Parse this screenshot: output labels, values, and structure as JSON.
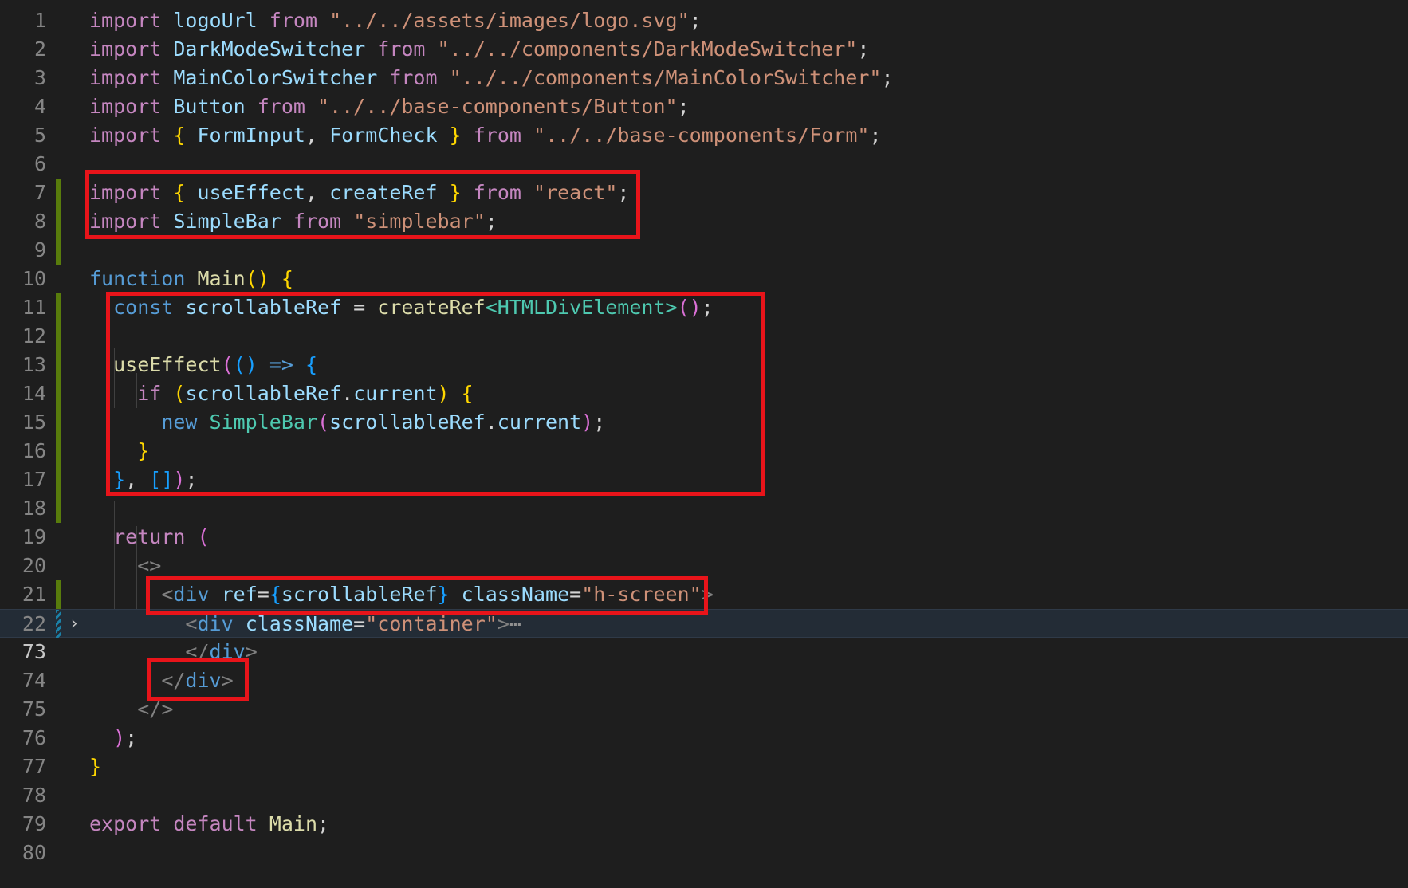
{
  "editor": {
    "lines": [
      {
        "n": "1",
        "tokens": [
          [
            "kw",
            "import"
          ],
          [
            "p",
            " "
          ],
          [
            "vr",
            "logoUrl"
          ],
          [
            "p",
            " "
          ],
          [
            "kw",
            "from"
          ],
          [
            "p",
            " "
          ],
          [
            "st",
            "\"../../assets/images/logo.svg\""
          ],
          [
            "p",
            ";"
          ]
        ]
      },
      {
        "n": "2",
        "tokens": [
          [
            "kw",
            "import"
          ],
          [
            "p",
            " "
          ],
          [
            "vr",
            "DarkModeSwitcher"
          ],
          [
            "p",
            " "
          ],
          [
            "kw",
            "from"
          ],
          [
            "p",
            " "
          ],
          [
            "st",
            "\"../../components/DarkModeSwitcher\""
          ],
          [
            "p",
            ";"
          ]
        ]
      },
      {
        "n": "3",
        "tokens": [
          [
            "kw",
            "import"
          ],
          [
            "p",
            " "
          ],
          [
            "vr",
            "MainColorSwitcher"
          ],
          [
            "p",
            " "
          ],
          [
            "kw",
            "from"
          ],
          [
            "p",
            " "
          ],
          [
            "st",
            "\"../../components/MainColorSwitcher\""
          ],
          [
            "p",
            ";"
          ]
        ]
      },
      {
        "n": "4",
        "tokens": [
          [
            "kw",
            "import"
          ],
          [
            "p",
            " "
          ],
          [
            "vr",
            "Button"
          ],
          [
            "p",
            " "
          ],
          [
            "kw",
            "from"
          ],
          [
            "p",
            " "
          ],
          [
            "st",
            "\"../../base-components/Button\""
          ],
          [
            "p",
            ";"
          ]
        ]
      },
      {
        "n": "5",
        "tokens": [
          [
            "kw",
            "import"
          ],
          [
            "p",
            " "
          ],
          [
            "p1",
            "{"
          ],
          [
            "p",
            " "
          ],
          [
            "vr",
            "FormInput"
          ],
          [
            "p",
            ", "
          ],
          [
            "vr",
            "FormCheck"
          ],
          [
            "p",
            " "
          ],
          [
            "p1",
            "}"
          ],
          [
            "p",
            " "
          ],
          [
            "kw",
            "from"
          ],
          [
            "p",
            " "
          ],
          [
            "st",
            "\"../../base-components/Form\""
          ],
          [
            "p",
            ";"
          ]
        ]
      },
      {
        "n": "6",
        "tokens": []
      },
      {
        "n": "7",
        "tokens": [
          [
            "kw",
            "import"
          ],
          [
            "p",
            " "
          ],
          [
            "p1",
            "{"
          ],
          [
            "p",
            " "
          ],
          [
            "vr",
            "useEffect"
          ],
          [
            "p",
            ", "
          ],
          [
            "vr",
            "createRef"
          ],
          [
            "p",
            " "
          ],
          [
            "p1",
            "}"
          ],
          [
            "p",
            " "
          ],
          [
            "kw",
            "from"
          ],
          [
            "p",
            " "
          ],
          [
            "st",
            "\"react\""
          ],
          [
            "p",
            ";"
          ]
        ]
      },
      {
        "n": "8",
        "tokens": [
          [
            "kw",
            "import"
          ],
          [
            "p",
            " "
          ],
          [
            "vr",
            "SimpleBar"
          ],
          [
            "p",
            " "
          ],
          [
            "kw",
            "from"
          ],
          [
            "p",
            " "
          ],
          [
            "st",
            "\"simplebar\""
          ],
          [
            "p",
            ";"
          ]
        ]
      },
      {
        "n": "9",
        "tokens": []
      },
      {
        "n": "10",
        "tokens": [
          [
            "bl",
            "function"
          ],
          [
            "p",
            " "
          ],
          [
            "fn",
            "Main"
          ],
          [
            "p1",
            "()"
          ],
          [
            "p",
            " "
          ],
          [
            "p1",
            "{"
          ]
        ]
      },
      {
        "n": "11",
        "tokens": [
          [
            "p",
            "  "
          ],
          [
            "bl",
            "const"
          ],
          [
            "p",
            " "
          ],
          [
            "vr",
            "scrollableRef"
          ],
          [
            "p",
            " = "
          ],
          [
            "fn",
            "createRef"
          ],
          [
            "ty",
            "<HTMLDivElement>"
          ],
          [
            "p2",
            "()"
          ],
          [
            "p",
            ";"
          ]
        ]
      },
      {
        "n": "12",
        "tokens": []
      },
      {
        "n": "13",
        "tokens": [
          [
            "p",
            "  "
          ],
          [
            "fn",
            "useEffect"
          ],
          [
            "p2",
            "("
          ],
          [
            "p3",
            "()"
          ],
          [
            "p",
            " "
          ],
          [
            "bl",
            "=>"
          ],
          [
            "p",
            " "
          ],
          [
            "p3",
            "{"
          ]
        ]
      },
      {
        "n": "14",
        "tokens": [
          [
            "p",
            "    "
          ],
          [
            "kw",
            "if"
          ],
          [
            "p",
            " "
          ],
          [
            "p1",
            "("
          ],
          [
            "vr",
            "scrollableRef"
          ],
          [
            "p",
            "."
          ],
          [
            "vr",
            "current"
          ],
          [
            "p1",
            ")"
          ],
          [
            "p",
            " "
          ],
          [
            "p1",
            "{"
          ]
        ]
      },
      {
        "n": "15",
        "tokens": [
          [
            "p",
            "      "
          ],
          [
            "bl",
            "new"
          ],
          [
            "p",
            " "
          ],
          [
            "ty",
            "SimpleBar"
          ],
          [
            "p2",
            "("
          ],
          [
            "vr",
            "scrollableRef"
          ],
          [
            "p",
            "."
          ],
          [
            "vr",
            "current"
          ],
          [
            "p2",
            ")"
          ],
          [
            "p",
            ";"
          ]
        ]
      },
      {
        "n": "16",
        "tokens": [
          [
            "p",
            "    "
          ],
          [
            "p1",
            "}"
          ]
        ]
      },
      {
        "n": "17",
        "tokens": [
          [
            "p",
            "  "
          ],
          [
            "p3",
            "}"
          ],
          [
            "p",
            ", "
          ],
          [
            "p3",
            "[]"
          ],
          [
            "p2",
            ")"
          ],
          [
            "p",
            ";"
          ]
        ]
      },
      {
        "n": "18",
        "tokens": []
      },
      {
        "n": "19",
        "tokens": [
          [
            "p",
            "  "
          ],
          [
            "kw",
            "return"
          ],
          [
            "p",
            " "
          ],
          [
            "p2",
            "("
          ]
        ]
      },
      {
        "n": "20",
        "tokens": [
          [
            "p",
            "    "
          ],
          [
            "tg",
            "<>"
          ]
        ]
      },
      {
        "n": "21",
        "tokens": [
          [
            "p",
            "      "
          ],
          [
            "tg",
            "<"
          ],
          [
            "bl",
            "div"
          ],
          [
            "p",
            " "
          ],
          [
            "vr",
            "ref"
          ],
          [
            "p",
            "="
          ],
          [
            "p3",
            "{"
          ],
          [
            "vr",
            "scrollableRef"
          ],
          [
            "p3",
            "}"
          ],
          [
            "p",
            " "
          ],
          [
            "vr",
            "className"
          ],
          [
            "p",
            "="
          ],
          [
            "st",
            "\"h-screen\""
          ],
          [
            "tg",
            ">"
          ]
        ]
      },
      {
        "n": "22",
        "tokens": [
          [
            "p",
            "        "
          ],
          [
            "tg",
            "<"
          ],
          [
            "bl",
            "div"
          ],
          [
            "p",
            " "
          ],
          [
            "vr",
            "className"
          ],
          [
            "p",
            "="
          ],
          [
            "st",
            "\"container\""
          ],
          [
            "tg",
            ">"
          ],
          [
            "ellipsis",
            "⋯"
          ]
        ]
      },
      {
        "n": "73",
        "tokens": [
          [
            "p",
            "        "
          ],
          [
            "tg",
            "</"
          ],
          [
            "bl",
            "div"
          ],
          [
            "tg",
            ">"
          ]
        ]
      },
      {
        "n": "74",
        "tokens": [
          [
            "p",
            "      "
          ],
          [
            "tg",
            "</"
          ],
          [
            "bl",
            "div"
          ],
          [
            "tg",
            ">"
          ]
        ]
      },
      {
        "n": "75",
        "tokens": [
          [
            "p",
            "    "
          ],
          [
            "tg",
            "</>"
          ]
        ]
      },
      {
        "n": "76",
        "tokens": [
          [
            "p",
            "  "
          ],
          [
            "p2",
            ")"
          ],
          [
            "p",
            ";"
          ]
        ]
      },
      {
        "n": "77",
        "tokens": [
          [
            "p1",
            "}"
          ]
        ]
      },
      {
        "n": "78",
        "tokens": []
      },
      {
        "n": "79",
        "tokens": [
          [
            "kw",
            "export"
          ],
          [
            "p",
            " "
          ],
          [
            "kw",
            "default"
          ],
          [
            "p",
            " "
          ],
          [
            "fn",
            "Main"
          ],
          [
            "p",
            ";"
          ]
        ]
      },
      {
        "n": "80",
        "tokens": []
      }
    ],
    "active_line": "73",
    "current_line_highlight": "22",
    "folded_line": "22",
    "modified_lines": [
      "7",
      "8",
      "9",
      "11",
      "12",
      "13",
      "14",
      "15",
      "16",
      "17",
      "18",
      "21"
    ],
    "fold_icon": "chevron-right-icon",
    "highlight_color": "#e8141a"
  }
}
